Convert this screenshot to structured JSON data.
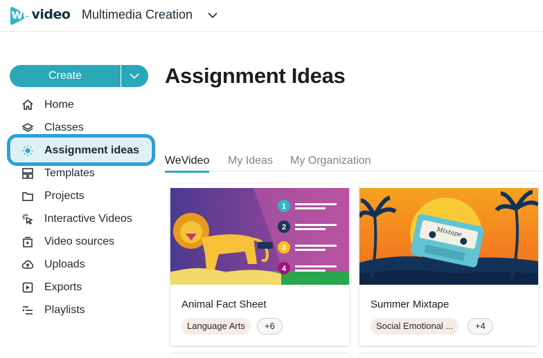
{
  "app": {
    "logo_text_we": "we",
    "logo_text_video": "video",
    "workspace_name": "Multimedia Creation"
  },
  "sidebar": {
    "create_label": "Create",
    "items": [
      {
        "label": "Home",
        "icon": "home-icon"
      },
      {
        "label": "Classes",
        "icon": "layers-icon"
      },
      {
        "label": "Assignment ideas",
        "icon": "lightbulb-icon",
        "active": true
      },
      {
        "label": "Templates",
        "icon": "templates-icon"
      },
      {
        "label": "Projects",
        "icon": "folder-icon"
      },
      {
        "label": "Interactive Videos",
        "icon": "cursor-click-icon"
      },
      {
        "label": "Video sources",
        "icon": "video-source-icon"
      },
      {
        "label": "Uploads",
        "icon": "cloud-upload-icon"
      },
      {
        "label": "Exports",
        "icon": "export-icon"
      },
      {
        "label": "Playlists",
        "icon": "playlist-icon"
      }
    ]
  },
  "main": {
    "title": "Assignment Ideas",
    "tabs": [
      {
        "label": "WeVideo",
        "active": true
      },
      {
        "label": "My Ideas",
        "active": false
      },
      {
        "label": "My Organization",
        "active": false
      }
    ],
    "cards": [
      {
        "title": "Animal Fact Sheet",
        "tag": "Language Arts",
        "more": "+6",
        "list_numbers": [
          "1",
          "2",
          "3",
          "4"
        ]
      },
      {
        "title": "Summer Mixtape",
        "tag": "Social Emotional ...",
        "more": "+4",
        "cassette_label": "Mixtape"
      }
    ]
  },
  "colors": {
    "accent": "#2ba8b8",
    "highlight_ring": "#2aa0d8",
    "active_bg": "#dff0f6",
    "chip_bg": "#f6ece6"
  }
}
